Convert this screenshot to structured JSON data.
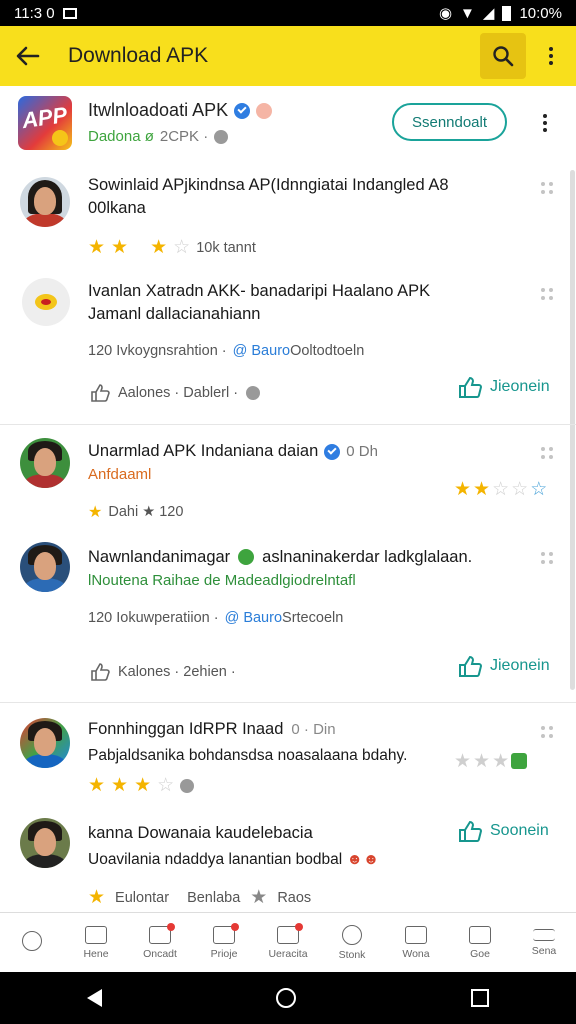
{
  "status_bar": {
    "time": "11:3 0",
    "right_time": "10:0%"
  },
  "app_bar": {
    "title": "Download APK"
  },
  "header": {
    "logo_text": "APP",
    "name": "Itwlnloadoati APK",
    "sub_green": "Dadona ø",
    "sub_gray": "2CPK ·",
    "download_label": "Ssenndoalt"
  },
  "items": [
    {
      "title": "Sowinlaid APjkindnsa AP(Idnngiatai Indangled A8 00lkana",
      "meta": "10k  tannt",
      "stars": [
        1,
        0.5,
        0,
        1,
        0.5
      ]
    },
    {
      "title": "Ivanlan Xatradn AKK- banadaripi Haalano APK Jamanl dallacianahiann",
      "meta_left": "120 Ivkoygnsrahtion ·",
      "meta_blue": "@ Bauro",
      "meta_right": "Ooltodtoeln",
      "action_label": "Aalones · Dablerl ·",
      "like_label": "Jieonein"
    },
    {
      "title": "Unarmlad APK Indaniana daian",
      "title_suffix": "0 Dh",
      "sub_orange": "Anfdaaml",
      "meta": "Dahi ★ 120"
    },
    {
      "title": "Nawnlandanimagar",
      "title_rest": "aslnaninakerdar ladkglalaan.",
      "sub_green": "lNoutena Raihae de Madeadlgiodrelntafl",
      "meta_left": "120 Iokuwperatiion ·",
      "meta_blue": "@ Bauro",
      "meta_right": "Srtecoeln",
      "action_label": "Kalones · 2ehien ·",
      "like_label": "Jieonein"
    },
    {
      "title": "Fonnhinggan IdRPR Inaad",
      "title_suffix": "0 · Din",
      "sub": "Pabjaldsanika bohdansdsa noasalaana bdahy."
    },
    {
      "title": "kanna Dowanaia kaudelebacia",
      "sub": "Uoavilania ndaddya lanantian bodbal",
      "like_label": "Soonein",
      "footer_a": "Eulontar",
      "footer_b": "Benlaba",
      "footer_c": "Raos"
    }
  ],
  "bottom_nav": [
    {
      "label": "",
      "icon": "circle-arrow-icon"
    },
    {
      "label": "Hene",
      "icon": "home-icon"
    },
    {
      "label": "Oncadt",
      "icon": "chat-icon",
      "badge": true
    },
    {
      "label": "Prioje",
      "icon": "grid-icon",
      "badge": true
    },
    {
      "label": "Ueracita",
      "icon": "tag-icon",
      "badge": true
    },
    {
      "label": "Stonk",
      "icon": "info-icon"
    },
    {
      "label": "Wona",
      "icon": "book-icon"
    },
    {
      "label": "Goe",
      "icon": "square-icon"
    },
    {
      "label": "Sena",
      "icon": "menu-icon"
    }
  ]
}
